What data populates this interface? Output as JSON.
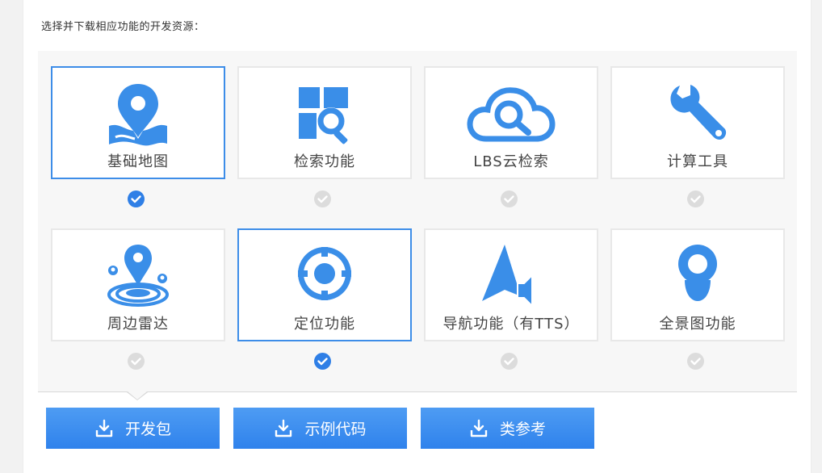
{
  "intro": "选择并下载相应功能的开发资源：",
  "features": [
    {
      "label": "基础地图",
      "icon": "map-pin-icon",
      "selected": true
    },
    {
      "label": "检索功能",
      "icon": "search-grid-icon",
      "selected": false
    },
    {
      "label": "LBS云检索",
      "icon": "cloud-search-icon",
      "selected": false
    },
    {
      "label": "计算工具",
      "icon": "wrench-icon",
      "selected": false
    },
    {
      "label": "周边雷达",
      "icon": "radar-pin-icon",
      "selected": false
    },
    {
      "label": "定位功能",
      "icon": "locate-target-icon",
      "selected": true
    },
    {
      "label": "导航功能（有TTS）",
      "icon": "navigation-arrow-icon",
      "selected": false
    },
    {
      "label": "全景图功能",
      "icon": "panorama-icon",
      "selected": false
    }
  ],
  "buttons": [
    {
      "label": "开发包",
      "icon": "download-icon"
    },
    {
      "label": "示例代码",
      "icon": "download-icon"
    },
    {
      "label": "类参考",
      "icon": "download-icon"
    }
  ],
  "colors": {
    "accent": "#3d8de8",
    "icon_blue": "#3a8ee8",
    "check_on": "#2f7fe6",
    "check_off": "#dcdcdc",
    "button": "#3a8cee"
  }
}
